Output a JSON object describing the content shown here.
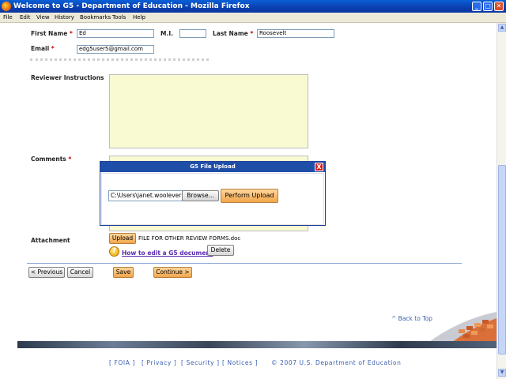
{
  "window": {
    "title": "Welcome to G5 - Department of Education",
    "title_suffix": " - Mozilla Firefox"
  },
  "menu": [
    "File",
    "Edit",
    "View",
    "History",
    "Bookmarks",
    "Tools",
    "Help"
  ],
  "form": {
    "first_name_label": "First Name",
    "first_name_value": "Ed",
    "mi_label": "M.I.",
    "mi_value": "",
    "last_name_label": "Last Name",
    "last_name_value": "Roosevelt",
    "email_label": "Email",
    "email_value": "edg5user5@gmail.com",
    "reviewer_instructions_label": "Reviewer Instructions",
    "comments_label": "Comments",
    "attachment_label": "Attachment",
    "required_marker": "*",
    "upload_button": "Upload",
    "attachment_filename": "FILE FOR OTHER REVIEW FORMS.doc",
    "help_link": "How to edit a G5 document",
    "delete_button": "Delete"
  },
  "modal": {
    "title": "G5 File Upload",
    "close_glyph": "X",
    "file_path": "C:\\Users\\janet.woolever",
    "browse_button": "Browse...",
    "perform_upload_button": "Perform Upload"
  },
  "nav": {
    "previous": "< Previous",
    "cancel": "Cancel",
    "save": "Save",
    "continue": "Continue >"
  },
  "back_to_top": "^ Back to Top",
  "footer": {
    "foia": "FOIA",
    "privacy": "Privacy",
    "security": "Security",
    "notices": "Notices",
    "copyright": "©  2007  U.S.  Department  of  Education"
  },
  "colors": {
    "title_bar": "#0a3fb0",
    "textarea_bg": "#fafad2",
    "orange_button": "#f3a64a",
    "link": "#3b5fb0"
  }
}
